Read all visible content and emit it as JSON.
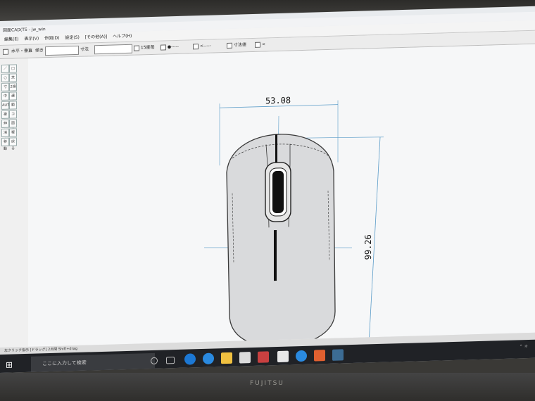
{
  "window": {
    "title": "図面CAD(TS - jw_win"
  },
  "menu": [
    "編集(E)",
    "表示(V)",
    "作図(D)",
    "設定(S)",
    "[その他(A)]",
    "ヘルプ(H)"
  ],
  "toolbar": {
    "layer_label": "水平・垂直",
    "tilt_label": "傾き",
    "dim_label": "寸法",
    "check1": "15度毎",
    "check2": "●-----",
    "check3": "<-----",
    "dim_value_label": "寸法値",
    "arrow_label": "<"
  },
  "tools": [
    "／",
    "□",
    "○",
    "文字",
    "寸法",
    "2線",
    "中心",
    "連線",
    "AUTO",
    "範囲",
    "複線",
    "コーナ",
    "伸縮",
    "面取",
    "消去",
    "複写",
    "移動",
    "戻る"
  ],
  "drawing": {
    "width_dim": "53.08",
    "height_dim": "99.26"
  },
  "status": {
    "text": "左クリック指示 [ドラッグ] 2点間 Shift+drag"
  },
  "taskbar": {
    "search_placeholder": "ここに入力して検索",
    "tray_text": "⌃ ☼"
  },
  "brand": "FUJITSU",
  "colors": {
    "dim_line": "#5a9cc8",
    "body_fill": "#d9dadc",
    "outline": "#3a3a3a"
  }
}
